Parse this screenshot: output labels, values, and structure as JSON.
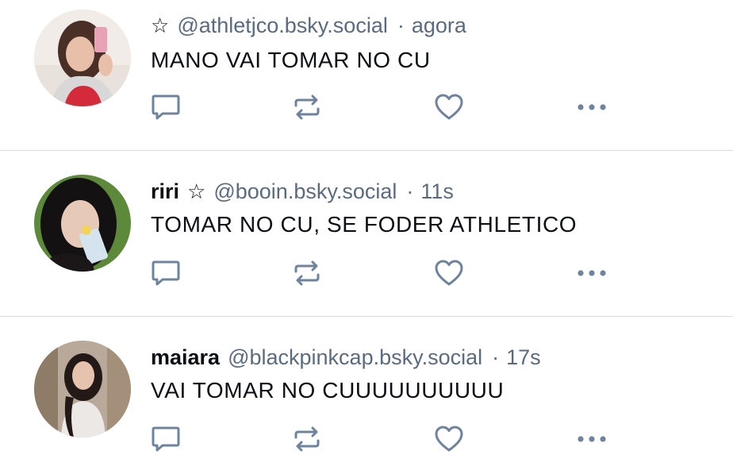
{
  "colors": {
    "text": "#0b0f14",
    "muted": "#5b6b7e",
    "icon": "#6f849c",
    "divider": "#d8dee6"
  },
  "icons": {
    "reply": "speech-bubble-icon",
    "repost": "repost-arrows-icon",
    "like": "heart-icon",
    "more": "ellipsis-icon",
    "badge": "star-outline-icon"
  },
  "posts": [
    {
      "display_name": "",
      "star": "☆",
      "handle": "@athletjco.bsky.social",
      "separator": "·",
      "time": "agora",
      "text": "MANO VAI TOMAR NO CU"
    },
    {
      "display_name": "riri",
      "star": "☆",
      "handle": "@booin.bsky.social",
      "separator": "·",
      "time": "11s",
      "text": "TOMAR NO CU, SE FODER ATHLETICO"
    },
    {
      "display_name": "maiara",
      "star": "",
      "handle": "@blackpinkcap.bsky.social",
      "separator": "·",
      "time": "17s",
      "text": "VAI TOMAR NO CUUUUUUUUUU"
    }
  ]
}
